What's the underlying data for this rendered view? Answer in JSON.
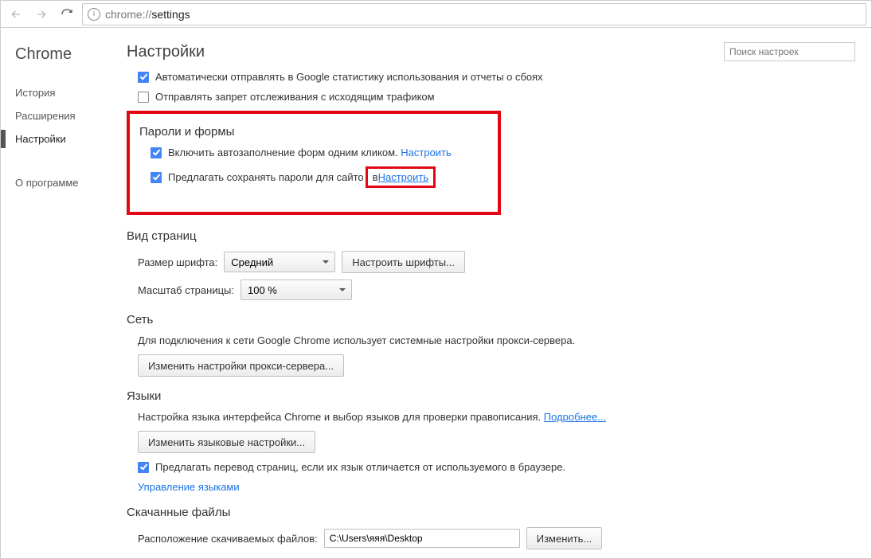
{
  "toolbar": {
    "url_prefix": "chrome://",
    "url_rest": "settings"
  },
  "sidebar": {
    "brand": "Chrome",
    "items": [
      {
        "label": "История"
      },
      {
        "label": "Расширения"
      },
      {
        "label": "Настройки"
      }
    ],
    "about": "О программе"
  },
  "header": {
    "title": "Настройки",
    "search_placeholder": "Поиск настроек"
  },
  "privacy": {
    "opt1_label": "Автоматически отправлять в Google статистику использования и отчеты о сбоях",
    "opt2_label": "Отправлять запрет отслеживания с исходящим трафиком"
  },
  "passwords": {
    "title": "Пароли и формы",
    "opt1_label": "Включить автозаполнение форм одним кликом.",
    "opt1_link": "Настроить",
    "opt2_label_a": "Предлагать сохранять пароли для сайто",
    "opt2_label_b": "в ",
    "opt2_link": "Настроить"
  },
  "appearance": {
    "title": "Вид страниц",
    "font_label": "Размер шрифта:",
    "font_value": "Средний",
    "font_button": "Настроить шрифты...",
    "zoom_label": "Масштаб страницы:",
    "zoom_value": "100 %"
  },
  "network": {
    "title": "Сеть",
    "desc": "Для подключения к сети Google Chrome использует системные настройки прокси-сервера.",
    "button": "Изменить настройки прокси-сервера..."
  },
  "languages": {
    "title": "Языки",
    "desc": "Настройка языка интерфейса Chrome и выбор языков для проверки правописания.",
    "learn_more": "Подробнее...",
    "button": "Изменить языковые настройки...",
    "translate_label": "Предлагать перевод страниц, если их язык отличается от используемого в браузере.",
    "manage_link": "Управление языками"
  },
  "downloads": {
    "title": "Скачанные файлы",
    "location_label": "Расположение скачиваемых файлов:",
    "location_value": "C:\\Users\\яяя\\Desktop",
    "change_button": "Изменить..."
  }
}
